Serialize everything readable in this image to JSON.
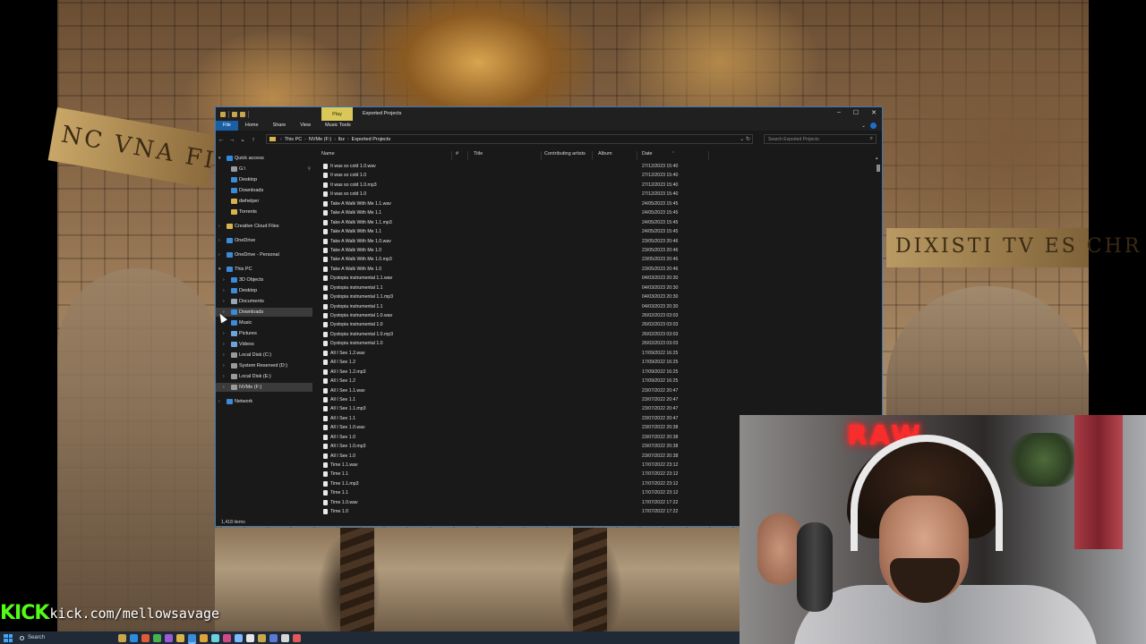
{
  "backdrop": {
    "inscription_left": "NC VNA FIDE",
    "inscription_right": "DIXISTI TV ES CHR"
  },
  "window": {
    "title": "Exported Projects",
    "context_tab": "Play",
    "controls": [
      "–",
      "☐",
      "✕"
    ]
  },
  "ribbon": {
    "tabs": [
      "File",
      "Home",
      "Share",
      "View",
      "Music Tools"
    ]
  },
  "address": {
    "crumbs": [
      "This PC",
      "NVMe (F:)",
      "lbz",
      "Exported Projects"
    ],
    "search_placeholder": "Search Exported Projects"
  },
  "sidebar": {
    "items": [
      {
        "label": "Quick access",
        "icon": "star-icon",
        "color": "#2e8be0",
        "chev": "▾",
        "indent": 0
      },
      {
        "label": "G:\\",
        "icon": "drive-icon",
        "color": "#9a9a9a",
        "chev": "",
        "indent": 1,
        "pinned": true
      },
      {
        "label": "Desktop",
        "icon": "folder-icon",
        "color": "#3d8ad6",
        "chev": "",
        "indent": 1
      },
      {
        "label": "Downloads",
        "icon": "download-icon",
        "color": "#3d8ad6",
        "chev": "",
        "indent": 1
      },
      {
        "label": "dwhelper",
        "icon": "folder-icon",
        "color": "#d9b44a",
        "chev": "",
        "indent": 1
      },
      {
        "label": "Torrents",
        "icon": "folder-icon",
        "color": "#d9b44a",
        "chev": "",
        "indent": 1
      },
      {
        "label": "Creative Cloud Files",
        "icon": "cloud-icon",
        "color": "#d9b44a",
        "chev": "›",
        "indent": 0
      },
      {
        "label": "OneDrive",
        "icon": "cloud-icon",
        "color": "#3d8ad6",
        "chev": "›",
        "indent": 0
      },
      {
        "label": "OneDrive - Personal",
        "icon": "cloud-icon",
        "color": "#3d8ad6",
        "chev": "›",
        "indent": 0
      },
      {
        "label": "This PC",
        "icon": "pc-icon",
        "color": "#3d8ad6",
        "chev": "▾",
        "indent": 0
      },
      {
        "label": "3D Objects",
        "icon": "cube-icon",
        "color": "#3d8ad6",
        "chev": "›",
        "indent": 1
      },
      {
        "label": "Desktop",
        "icon": "folder-icon",
        "color": "#3d8ad6",
        "chev": "›",
        "indent": 1
      },
      {
        "label": "Documents",
        "icon": "document-icon",
        "color": "#9aa6b4",
        "chev": "›",
        "indent": 1
      },
      {
        "label": "Downloads",
        "icon": "download-icon",
        "color": "#3d8ad6",
        "chev": "›",
        "indent": 1,
        "selected": true
      },
      {
        "label": "Music",
        "icon": "music-icon",
        "color": "#3d8ad6",
        "chev": "›",
        "indent": 1
      },
      {
        "label": "Pictures",
        "icon": "picture-icon",
        "color": "#6fa3d9",
        "chev": "›",
        "indent": 1
      },
      {
        "label": "Videos",
        "icon": "video-icon",
        "color": "#6fa3d9",
        "chev": "›",
        "indent": 1
      },
      {
        "label": "Local Disk (C:)",
        "icon": "disk-icon",
        "color": "#9a9a9a",
        "chev": "›",
        "indent": 1
      },
      {
        "label": "System Reserved (D:)",
        "icon": "disk-icon",
        "color": "#9a9a9a",
        "chev": "›",
        "indent": 1
      },
      {
        "label": "Local Disk (E:)",
        "icon": "disk-icon",
        "color": "#9a9a9a",
        "chev": "›",
        "indent": 1
      },
      {
        "label": "NVMe (F:)",
        "icon": "disk-icon",
        "color": "#9a9a9a",
        "chev": "›",
        "indent": 1,
        "selected": true
      },
      {
        "label": "Network",
        "icon": "network-icon",
        "color": "#3d8ad6",
        "chev": "›",
        "indent": 0
      }
    ]
  },
  "columns": {
    "name": "Name",
    "number": "#",
    "title": "Title",
    "contributing_artists": "Contributing artists",
    "album": "Album",
    "date": "Date"
  },
  "files": [
    {
      "name": "It was so cold 1.0.wav",
      "date": "27/12/2023 15:40"
    },
    {
      "name": "It was so cold 1.0",
      "date": "27/12/2023 15:40"
    },
    {
      "name": "It was so cold 1.0.mp3",
      "date": "27/12/2023 15:40"
    },
    {
      "name": "It was so cold 1.0",
      "date": "27/12/2023 15:40"
    },
    {
      "name": "Take A Walk With Me 1.1.wav",
      "date": "24/05/2023 15:45"
    },
    {
      "name": "Take A Walk With Me 1.1",
      "date": "24/05/2023 15:45"
    },
    {
      "name": "Take A Walk With Me 1.1.mp3",
      "date": "24/05/2023 15:45"
    },
    {
      "name": "Take A Walk With Me 1.1",
      "date": "24/05/2023 15:45"
    },
    {
      "name": "Take A Walk With Me 1.0.wav",
      "date": "23/05/2023 20:46"
    },
    {
      "name": "Take A Walk With Me 1.0",
      "date": "23/05/2023 20:46"
    },
    {
      "name": "Take A Walk With Me 1.0.mp3",
      "date": "23/05/2023 20:46"
    },
    {
      "name": "Take A Walk With Me 1.0",
      "date": "23/05/2023 20:46"
    },
    {
      "name": "Dystopia instrumental 1.1.wav",
      "date": "04/03/2023 20:30"
    },
    {
      "name": "Dystopia instrumental 1.1",
      "date": "04/03/2023 20:30"
    },
    {
      "name": "Dystopia instrumental 1.1.mp3",
      "date": "04/03/2023 20:30"
    },
    {
      "name": "Dystopia instrumental 1.1",
      "date": "04/03/2023 20:30"
    },
    {
      "name": "Dystopia instrumental 1.0.wav",
      "date": "26/02/2023 03:03"
    },
    {
      "name": "Dystopia instrumental 1.0",
      "date": "26/02/2023 03:03"
    },
    {
      "name": "Dystopia instrumental 1.0.mp3",
      "date": "26/02/2023 03:03"
    },
    {
      "name": "Dystopia instrumental 1.0",
      "date": "26/02/2023 03:03"
    },
    {
      "name": "All I See 1.2.wav",
      "date": "17/09/2022 16:25"
    },
    {
      "name": "All I See 1.2",
      "date": "17/09/2022 16:25"
    },
    {
      "name": "All I See 1.2.mp3",
      "date": "17/09/2022 16:25"
    },
    {
      "name": "All I See 1.2",
      "date": "17/09/2022 16:25"
    },
    {
      "name": "All I See 1.1.wav",
      "date": "23/07/2022 20:47"
    },
    {
      "name": "All I See 1.1",
      "date": "23/07/2022 20:47"
    },
    {
      "name": "All I See 1.1.mp3",
      "date": "23/07/2022 20:47"
    },
    {
      "name": "All I See 1.1",
      "date": "23/07/2022 20:47"
    },
    {
      "name": "All I See 1.0.wav",
      "date": "23/07/2022 20:38"
    },
    {
      "name": "All I See 1.0",
      "date": "23/07/2022 20:38"
    },
    {
      "name": "All I See 1.0.mp3",
      "date": "23/07/2022 20:38"
    },
    {
      "name": "All I See 1.0",
      "date": "23/07/2022 20:38"
    },
    {
      "name": "Time 1.1.wav",
      "date": "17/07/2022 23:12"
    },
    {
      "name": "Time 1.1",
      "date": "17/07/2022 23:12"
    },
    {
      "name": "Time 1.1.mp3",
      "date": "17/07/2022 23:12"
    },
    {
      "name": "Time 1.1",
      "date": "17/07/2022 23:12"
    },
    {
      "name": "Time 1.0.wav",
      "date": "17/07/2022 17:22"
    },
    {
      "name": "Time 1.0",
      "date": "17/07/2022 17:22"
    }
  ],
  "status": {
    "item_count": "1,418 items"
  },
  "webcam": {
    "sign_text": "RAW"
  },
  "stream": {
    "kick_logo": "KICK",
    "url": "kick.com/mellowsavage"
  },
  "taskbar": {
    "search_label": "Search",
    "app_colors": [
      "#c9a64a",
      "#2e8be0",
      "#e05a3a",
      "#4caf50",
      "#9c5ad6",
      "#d9b44a",
      "#3d8ad6",
      "#e0a23a",
      "#6ad0e0",
      "#d04a8a",
      "#7fb8ff",
      "#e6e6e6",
      "#c9a64a",
      "#5a78d6",
      "#d6d6d6",
      "#e05a5a"
    ]
  }
}
